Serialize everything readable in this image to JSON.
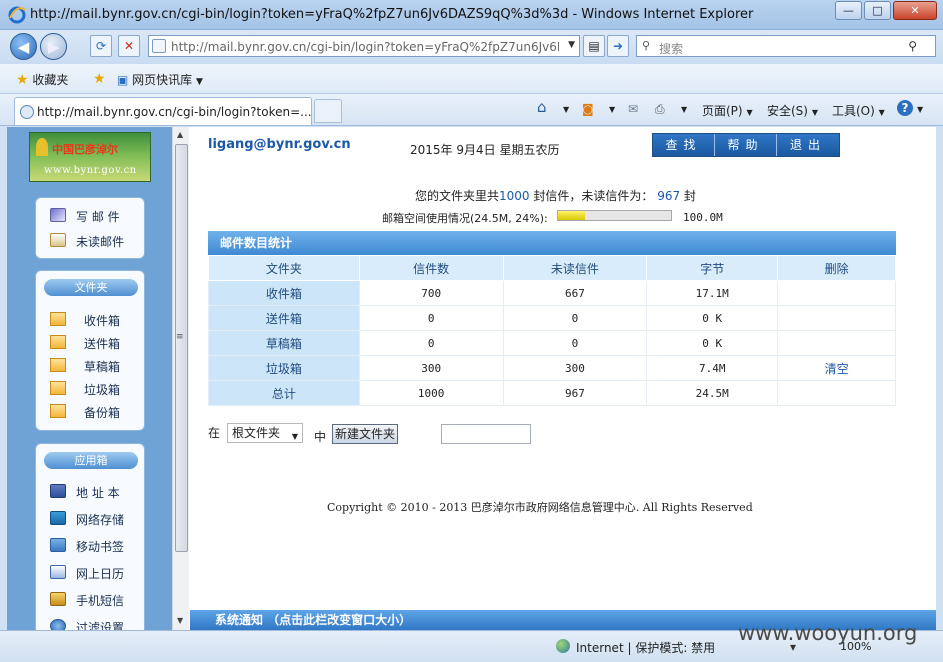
{
  "window": {
    "title": "http://mail.bynr.gov.cn/cgi-bin/login?token=yFraQ%2fpZ7un6Jv6DAZS9qQ%3d%3d - Windows Internet Explorer",
    "minimize": "—",
    "maximize": "□",
    "close": "✕"
  },
  "navbar": {
    "address": "http://mail.bynr.gov.cn/cgi-bin/login?token=yFraQ%2fpZ7un6Jv6DA",
    "search_placeholder": "搜索"
  },
  "favbar": {
    "favorites": "收藏夹",
    "quick_links": "网页快讯库"
  },
  "tabbar": {
    "tab_title": "http://mail.bynr.gov.cn/cgi-bin/login?token=...",
    "page_menu": "页面(P)",
    "safety_menu": "安全(S)",
    "tools_menu": "工具(O)"
  },
  "sidebar": {
    "logo_line1": "中国巴彦淖尔",
    "logo_line2": "www.bynr.gov.cn",
    "quick": [
      {
        "label": "写 邮 件",
        "icon": "pen-icon"
      },
      {
        "label": "未读邮件",
        "icon": "unread-mail-icon"
      }
    ],
    "folders_title": "文件夹",
    "folders": [
      {
        "label": "收件箱",
        "icon": "envelope-icon"
      },
      {
        "label": "送件箱",
        "icon": "envelope-icon"
      },
      {
        "label": "草稿箱",
        "icon": "envelope-icon"
      },
      {
        "label": "垃圾箱",
        "icon": "envelope-icon"
      },
      {
        "label": "备份箱",
        "icon": "envelope-icon"
      }
    ],
    "apps_title": "应用箱",
    "apps": [
      {
        "label": "地 址 本",
        "icon": "address-book-icon"
      },
      {
        "label": "网络存储",
        "icon": "disk-icon"
      },
      {
        "label": "移动书签",
        "icon": "bookmark-icon"
      },
      {
        "label": "网上日历",
        "icon": "calendar-icon"
      },
      {
        "label": "手机短信",
        "icon": "sms-icon"
      },
      {
        "label": "过滤设置",
        "icon": "filter-icon"
      }
    ]
  },
  "header": {
    "user_email": "ligang@bynr.gov.cn",
    "date": "2015年  9月4日  星期五农历",
    "buttons": [
      "查找",
      "帮助",
      "退出"
    ]
  },
  "summary": {
    "prefix": "您的文件夹里共",
    "total": "1000",
    "middle": " 封信件，未读信件为：  ",
    "unread": "967",
    "suffix": " 封",
    "quota_label": "邮箱空间使用情况(24.5M, 24%):",
    "quota_percent": 24,
    "quota_total": "100.0M"
  },
  "stats": {
    "title": "邮件数目统计",
    "columns": [
      "文件夹",
      "信件数",
      "未读信件",
      "字节",
      "删除"
    ],
    "rows": [
      {
        "folder": "收件箱",
        "count": "700",
        "unread": "667",
        "bytes": "17.1M",
        "action": ""
      },
      {
        "folder": "送件箱",
        "count": "0",
        "unread": "0",
        "bytes": "0 K",
        "action": ""
      },
      {
        "folder": "草稿箱",
        "count": "0",
        "unread": "0",
        "bytes": "0 K",
        "action": ""
      },
      {
        "folder": "垃圾箱",
        "count": "300",
        "unread": "300",
        "bytes": "7.4M",
        "action": "清空"
      },
      {
        "folder": "总计",
        "count": "1000",
        "unread": "967",
        "bytes": "24.5M",
        "action": ""
      }
    ]
  },
  "newfolder": {
    "at": "在",
    "parent": "根文件夹",
    "in": "中",
    "button": "新建文件夹"
  },
  "footer": {
    "copyright": "Copyright © 2010 - 2013 巴彦淖尔市政府网络信息管理中心. All Rights Reserved",
    "system_notice": "系统通知 （点击此栏改变窗口大小）"
  },
  "statusbar": {
    "zone": "Internet | 保护模式: 禁用",
    "zoom": "100%"
  },
  "watermark": "www.wooyun.org"
}
